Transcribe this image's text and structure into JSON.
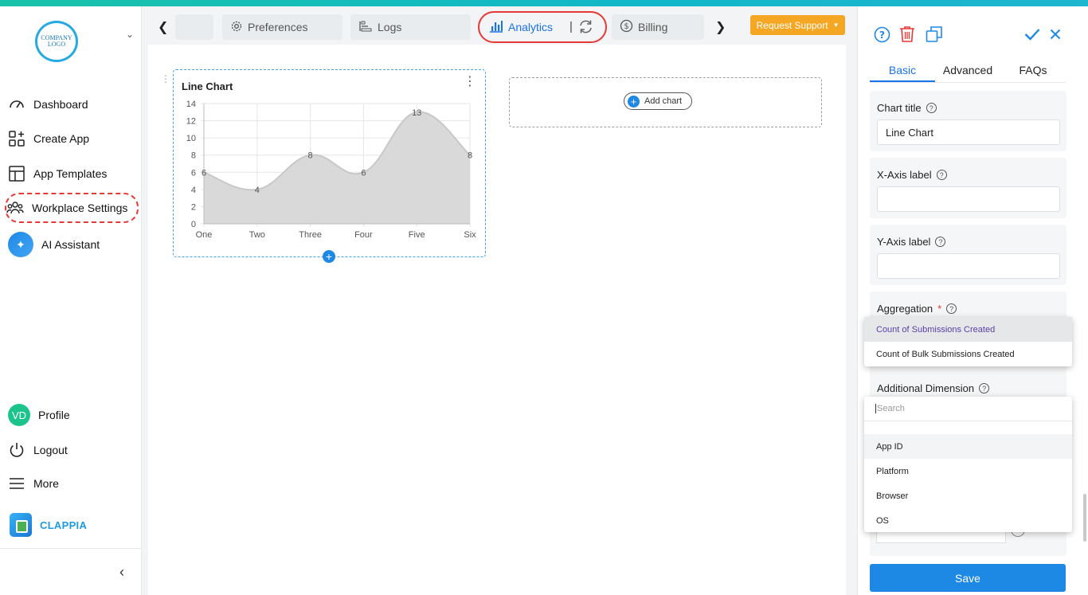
{
  "sidebar": {
    "logo_text": "COMPANY LOGO",
    "items": [
      {
        "label": "Dashboard",
        "icon": "gauge-icon"
      },
      {
        "label": "Create App",
        "icon": "grid-plus-icon"
      },
      {
        "label": "App Templates",
        "icon": "layout-icon"
      },
      {
        "label": "Workplace Settings",
        "icon": "users-icon"
      },
      {
        "label": "AI Assistant",
        "icon": "ai-assistant-icon"
      }
    ],
    "profile": {
      "initials": "VD",
      "label": "Profile"
    },
    "logout_label": "Logout",
    "more_label": "More",
    "brand": "CLAPPIA"
  },
  "tabs": {
    "items": [
      {
        "label": "",
        "icon": ""
      },
      {
        "label": "Preferences",
        "icon": "gear-icon"
      },
      {
        "label": "Logs",
        "icon": "logs-icon"
      },
      {
        "label": "Analytics",
        "icon": "bar-chart-icon",
        "active": true
      },
      {
        "label": "Billing",
        "icon": "dollar-icon"
      }
    ],
    "separator": "|",
    "request_support": "Request Support"
  },
  "canvas": {
    "add_chart_label": "Add chart"
  },
  "chart_data": {
    "type": "area",
    "title": "Line Chart",
    "categories": [
      "One",
      "Two",
      "Three",
      "Four",
      "Five",
      "Six"
    ],
    "values": [
      6,
      4,
      8,
      6,
      13,
      8
    ],
    "ylim": [
      0,
      14
    ],
    "yticks": [
      0,
      2,
      4,
      6,
      8,
      10,
      12,
      14
    ],
    "data_labels": true,
    "grid": true,
    "fill_color": "#d9d9d9",
    "line_color": "#c8c8c8"
  },
  "panel": {
    "tabs": [
      "Basic",
      "Advanced",
      "FAQs"
    ],
    "active_tab": "Basic",
    "chart_title_label": "Chart title",
    "chart_title_value": "Line Chart",
    "x_axis_label": "X-Axis label",
    "x_axis_value": "",
    "y_axis_label": "Y-Axis label",
    "y_axis_value": "",
    "aggregation_label": "Aggregation",
    "required_mark": "*",
    "aggregation_options": [
      "Count of Submissions Created",
      "Count of Bulk Submissions Created"
    ],
    "additional_dimension_label": "Additional Dimension",
    "search_placeholder": "Search",
    "dimension_options": [
      "App ID",
      "Platform",
      "Browser",
      "OS"
    ],
    "save_label": "Save",
    "help_glyph": "?"
  },
  "colors": {
    "accent": "#1e88e5",
    "warning": "#f5a623",
    "highlight": "#e53935",
    "brand": "#1d9be0"
  }
}
